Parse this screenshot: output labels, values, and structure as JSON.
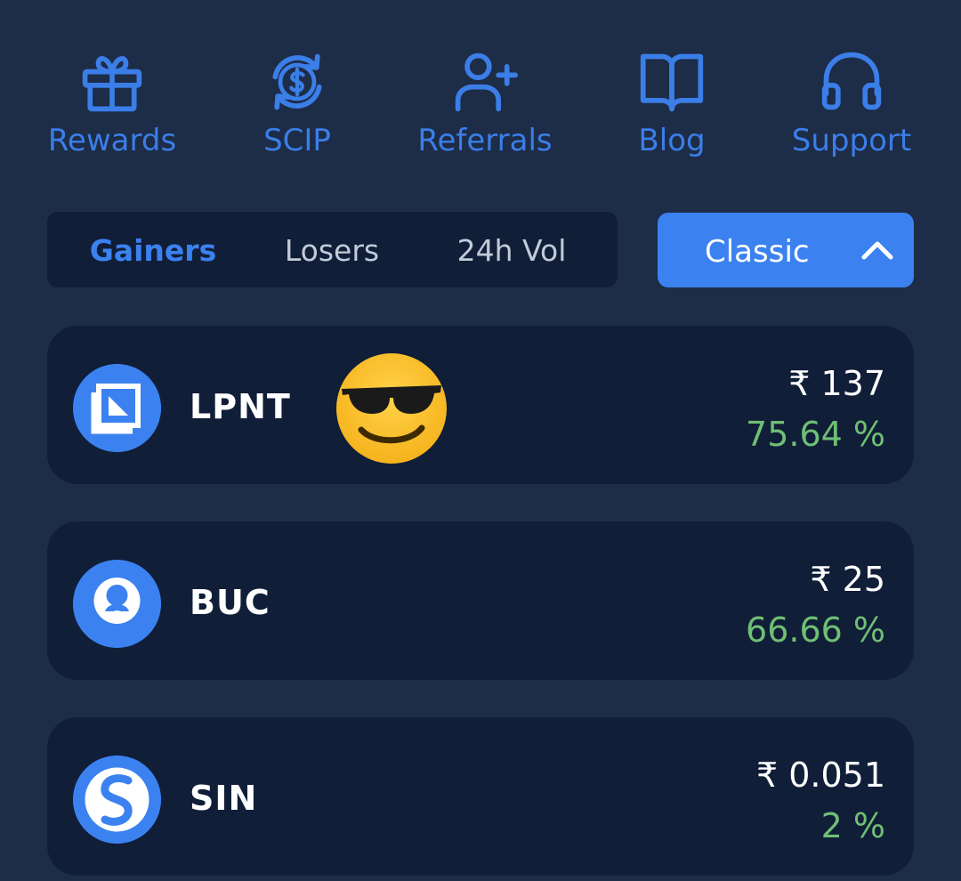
{
  "theme": {
    "background": "#1d2c47",
    "card": "#111e38",
    "accent": "#3b82f0",
    "positive": "#6fbf74"
  },
  "quick_links": [
    {
      "label": "Rewards",
      "icon": "gift-icon"
    },
    {
      "label": "SCIP",
      "icon": "dollar-cycle-icon"
    },
    {
      "label": "Referrals",
      "icon": "add-user-icon"
    },
    {
      "label": "Blog",
      "icon": "book-icon"
    },
    {
      "label": "Support",
      "icon": "headphones-icon"
    }
  ],
  "tabs": [
    {
      "label": "Gainers",
      "active": true
    },
    {
      "label": "Losers",
      "active": false
    },
    {
      "label": "24h Vol",
      "active": false
    }
  ],
  "view_select": {
    "value": "Classic",
    "icon": "chevron-up-icon"
  },
  "coins": [
    {
      "symbol": "LPNT",
      "price": "₹ 137",
      "change": "75.64 %"
    },
    {
      "symbol": "BUC",
      "price": "₹ 25",
      "change": "66.66 %"
    },
    {
      "symbol": "SIN",
      "price": "₹ 0.051",
      "change": "2 %"
    }
  ],
  "overlay": {
    "emoji": "sunglasses-emoji-icon"
  }
}
